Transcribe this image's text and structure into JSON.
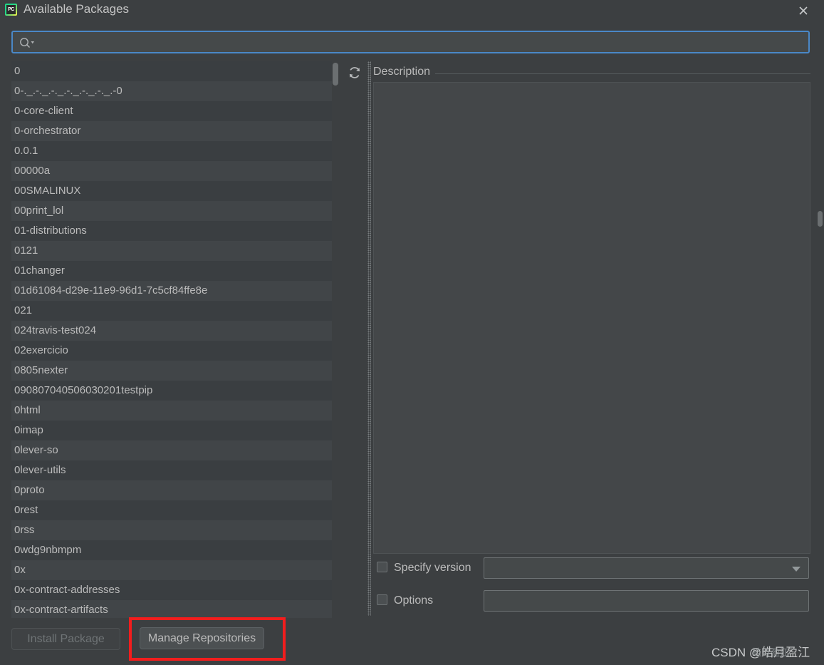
{
  "window": {
    "title": "Available Packages",
    "app_icon": "pycharm-icon",
    "app_icon_text": "PC",
    "close_icon": "close-icon"
  },
  "search": {
    "value": "",
    "placeholder": "",
    "icon": "search-icon"
  },
  "toolbar": {
    "refresh_icon": "refresh-icon"
  },
  "packages": [
    "0",
    "0-._.-._.-._.-._.-._.-._.-0",
    "0-core-client",
    "0-orchestrator",
    "0.0.1",
    "00000a",
    "00SMALINUX",
    "00print_lol",
    "01-distributions",
    "0121",
    "01changer",
    "01d61084-d29e-11e9-96d1-7c5cf84ffe8e",
    "021",
    "024travis-test024",
    "02exercicio",
    "0805nexter",
    "090807040506030201testpip",
    "0html",
    "0imap",
    "0lever-so",
    "0lever-utils",
    "0proto",
    "0rest",
    "0rss",
    "0wdg9nbmpm",
    "0x",
    "0x-contract-addresses",
    "0x-contract-artifacts"
  ],
  "description": {
    "label": "Description",
    "content": ""
  },
  "options": {
    "specify_version": {
      "label": "Specify version",
      "checked": false,
      "value": ""
    },
    "options_field": {
      "label": "Options",
      "checked": false,
      "value": "",
      "placeholder": ""
    }
  },
  "buttons": {
    "install": {
      "label": "Install Package",
      "enabled": false
    },
    "manage": {
      "label": "Manage Repositories",
      "enabled": true
    }
  },
  "annotation": {
    "highlight_color": "#f21d1d",
    "target": "Manage Repositories"
  },
  "watermark": {
    "text": "CSDN @皓月盈江",
    "ghost_text": "皓月盈江"
  },
  "colors": {
    "background": "#3c3f41",
    "row_odd": "#3a3e41",
    "row_even": "#414548",
    "text": "#bbbbbb",
    "focus_border": "#4a88c7",
    "field_bg": "#45494a"
  }
}
